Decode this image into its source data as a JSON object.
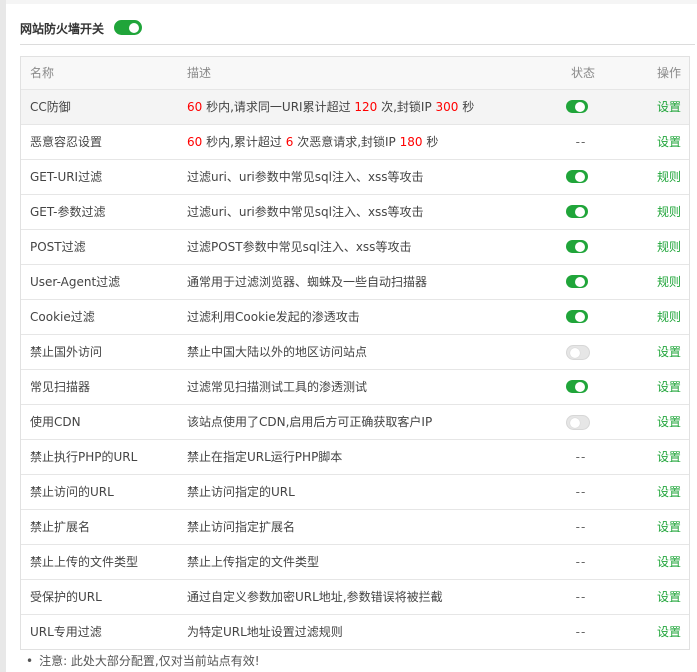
{
  "header": {
    "title": "网站防火墙开关",
    "master_on": true
  },
  "table": {
    "columns": {
      "name": "名称",
      "desc": "描述",
      "status": "状态",
      "op": "操作"
    },
    "rows": [
      {
        "name": "CC防御",
        "desc_parts": [
          "",
          "60",
          " 秒内,请求同一URI累计超过 ",
          "120",
          " 次,封锁IP ",
          "300",
          " 秒"
        ],
        "status": "on",
        "op": "设置"
      },
      {
        "name": "恶意容忍设置",
        "desc_parts": [
          "",
          "60",
          " 秒内,累计超过 ",
          "6",
          " 次恶意请求,封锁IP ",
          "180",
          " 秒"
        ],
        "status": "--",
        "op": "设置"
      },
      {
        "name": "GET-URI过滤",
        "desc": "过滤uri、uri参数中常见sql注入、xss等攻击",
        "status": "on",
        "op": "规则"
      },
      {
        "name": "GET-参数过滤",
        "desc": "过滤uri、uri参数中常见sql注入、xss等攻击",
        "status": "on",
        "op": "规则"
      },
      {
        "name": "POST过滤",
        "desc": "过滤POST参数中常见sql注入、xss等攻击",
        "status": "on",
        "op": "规则"
      },
      {
        "name": "User-Agent过滤",
        "desc": "通常用于过滤浏览器、蜘蛛及一些自动扫描器",
        "status": "on",
        "op": "规则"
      },
      {
        "name": "Cookie过滤",
        "desc": "过滤利用Cookie发起的渗透攻击",
        "status": "on",
        "op": "规则"
      },
      {
        "name": "禁止国外访问",
        "desc": "禁止中国大陆以外的地区访问站点",
        "status": "off",
        "op": "设置"
      },
      {
        "name": "常见扫描器",
        "desc": "过滤常见扫描测试工具的渗透测试",
        "status": "on",
        "op": "设置"
      },
      {
        "name": "使用CDN",
        "desc": "该站点使用了CDN,启用后方可正确获取客户IP",
        "status": "off",
        "op": "设置"
      },
      {
        "name": "禁止执行PHP的URL",
        "desc": "禁止在指定URL运行PHP脚本",
        "status": "--",
        "op": "设置"
      },
      {
        "name": "禁止访问的URL",
        "desc": "禁止访问指定的URL",
        "status": "--",
        "op": "设置"
      },
      {
        "name": "禁止扩展名",
        "desc": "禁止访问指定扩展名",
        "status": "--",
        "op": "设置"
      },
      {
        "name": "禁止上传的文件类型",
        "desc": "禁止上传指定的文件类型",
        "status": "--",
        "op": "设置"
      },
      {
        "name": "受保护的URL",
        "desc": "通过自定义参数加密URL地址,参数错误将被拦截",
        "status": "--",
        "op": "设置"
      },
      {
        "name": "URL专用过滤",
        "desc": "为特定URL地址设置过滤规则",
        "status": "--",
        "op": "设置"
      }
    ]
  },
  "footer": {
    "bullet": "•",
    "note": "注意: 此处大部分配置,仅对当前站点有效!"
  },
  "colors": {
    "accent": "#20a53a",
    "number": "#ff0000",
    "toggle_off": "#e6e6e6"
  }
}
